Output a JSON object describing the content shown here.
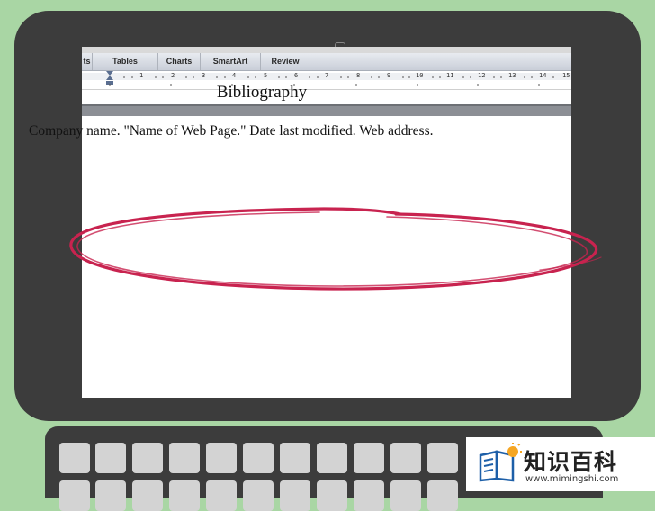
{
  "ribbon": {
    "tabs": [
      {
        "label": "ts"
      },
      {
        "label": "Tables"
      },
      {
        "label": "Charts"
      },
      {
        "label": "SmartArt"
      },
      {
        "label": "Review"
      }
    ]
  },
  "ruler": {
    "numbers": [
      "1",
      "2",
      "3",
      "4",
      "5",
      "6",
      "7",
      "8",
      "9",
      "10",
      "11",
      "12",
      "13",
      "14",
      "15"
    ]
  },
  "document": {
    "heading": "Bibliography",
    "citation": "Company name. \"Name of Web Page.\" Date last modified. Web address."
  },
  "annotation": {
    "color": "#c8234f"
  },
  "watermark": {
    "brand": "知识百科",
    "url": "www.mimingshi.com"
  }
}
